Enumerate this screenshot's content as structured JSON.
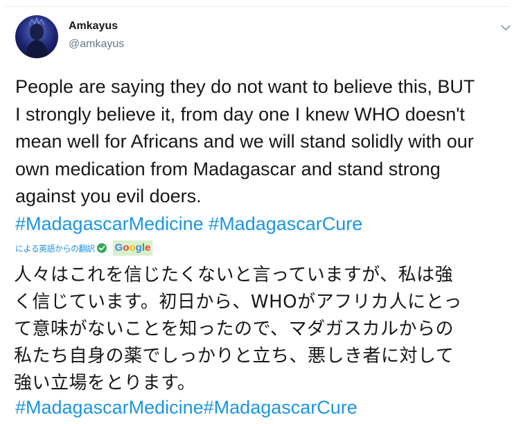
{
  "user": {
    "display_name": "Amkayus",
    "screen_name": "@amkayus"
  },
  "tweet": {
    "text_lines": [
      "People are saying they do not want to believe this, BUT",
      "I strongly believe it, from day one I knew WHO doesn't",
      "mean well for Africans and we will stand solidly with our",
      "own medication from Madagascar and stand strong",
      "against you evil doers."
    ],
    "hashtags": [
      "#MadagascarMedicine",
      "#MadagascarCure"
    ]
  },
  "translation": {
    "note": "による英語からの翻訳",
    "provider": "Google",
    "provider_letters": [
      {
        "ch": "G",
        "color": "#4285f4"
      },
      {
        "ch": "o",
        "color": "#ea4335"
      },
      {
        "ch": "o",
        "color": "#fbbc05"
      },
      {
        "ch": "g",
        "color": "#4285f4"
      },
      {
        "ch": "l",
        "color": "#34a853"
      },
      {
        "ch": "e",
        "color": "#ea4335"
      }
    ],
    "text_lines": [
      "人々はこれを信じたくないと言っていますが、私は強",
      "く信じています。初日から、WHOがアフリカ人にとっ",
      "て意味がないことを知ったので、マダガスカルからの",
      "私たち自身の薬でしっかりと立ち、悪しき者に対して",
      "強い立場をとります。"
    ],
    "hashtags": [
      "#MadagascarMedicine",
      "#MadagascarCure"
    ]
  },
  "icons": {
    "caret": "chevron-down-icon",
    "verified_check": "check-circle-icon"
  },
  "colors": {
    "link": "#1b95e0",
    "text": "#14171a",
    "secondary": "#657786",
    "google_badge_bg": "#d9f0c8",
    "check_green": "#34a853"
  }
}
